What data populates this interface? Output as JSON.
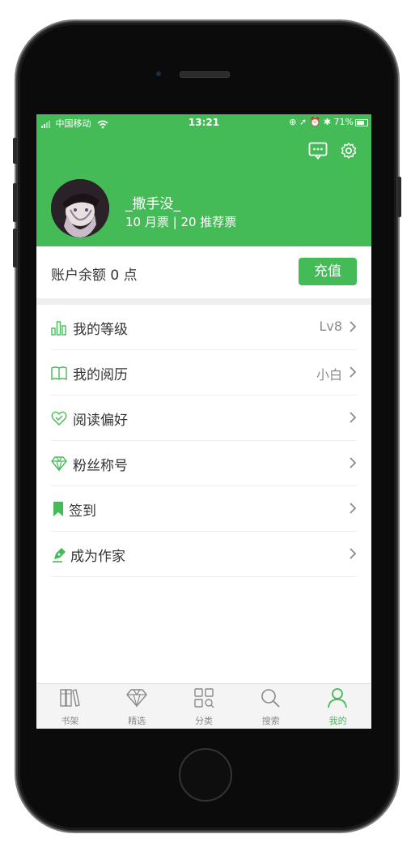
{
  "status_bar": {
    "carrier": "中国移动",
    "time": "13:21",
    "battery": "71%",
    "battery_level": 0.71
  },
  "header": {
    "username": "_撒手没_",
    "tickets": "10 月票 | 20 推荐票",
    "message_icon": "message-icon",
    "settings_icon": "gear-icon"
  },
  "account": {
    "balance": "账户余额 0 点",
    "recharge_label": "充值"
  },
  "menu": {
    "items": [
      {
        "label": "我的等级",
        "value": "Lv8",
        "icon": "level-icon"
      },
      {
        "label": "我的阅历",
        "value": "小白",
        "icon": "book-icon"
      },
      {
        "label": "阅读偏好",
        "value": "",
        "icon": "heart-icon"
      },
      {
        "label": "粉丝称号",
        "value": "",
        "icon": "diamond-icon"
      },
      {
        "label": "签到",
        "value": "",
        "icon": "bookmark-icon"
      },
      {
        "label": "成为作家",
        "value": "",
        "icon": "pen-icon"
      }
    ]
  },
  "tabbar": {
    "tabs": [
      {
        "label": "书架",
        "icon": "bookshelf-icon"
      },
      {
        "label": "精选",
        "icon": "diamond-icon"
      },
      {
        "label": "分类",
        "icon": "grid-search-icon"
      },
      {
        "label": "搜索",
        "icon": "search-icon"
      },
      {
        "label": "我的",
        "icon": "person-icon"
      }
    ],
    "active": "我的"
  },
  "colors": {
    "accent": "#45bb57",
    "text": "#333333",
    "muted": "#8a8a8a"
  }
}
